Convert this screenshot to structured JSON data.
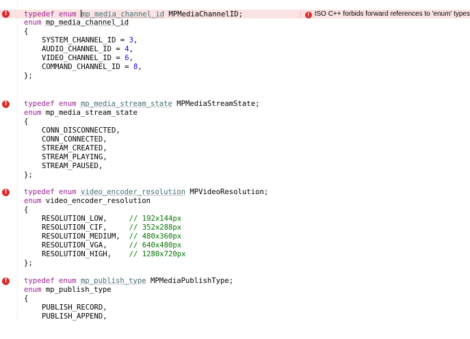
{
  "editor": {
    "error_message": "ISO C++ forbids forward references to 'enum' types",
    "error_marker": "!",
    "blocks": [
      {
        "typedef_kw": "typedef enum",
        "tag": "mp_media_channel_id",
        "typedef_name": "MPMediaChannelID;",
        "enum_kw": "enum",
        "enum_name": "mp_media_channel_id",
        "open": "{",
        "close": "};",
        "items": [
          {
            "name": "SYSTEM_CHANNEL_ID = ",
            "value": "3",
            "tail": ","
          },
          {
            "name": "AUDIO_CHANNEL_ID = ",
            "value": "4",
            "tail": ","
          },
          {
            "name": "VIDEO_CHANNEL_ID = ",
            "value": "6",
            "tail": ","
          },
          {
            "name": "COMMAND_CHANNEL_ID = ",
            "value": "8",
            "tail": ","
          }
        ]
      },
      {
        "typedef_kw": "typedef enum",
        "tag": "mp_media_stream_state",
        "typedef_name": "MPMediaStreamState;",
        "enum_kw": "enum",
        "enum_name": "mp_media_stream_state",
        "open": "{",
        "close": "};",
        "items": [
          {
            "name": "CONN_DISCONNECTED,"
          },
          {
            "name": "CONN_CONNECTED,"
          },
          {
            "name": "STREAM_CREATED,"
          },
          {
            "name": "STREAM_PLAYING,"
          },
          {
            "name": "STREAM_PAUSED,"
          }
        ]
      },
      {
        "typedef_kw": "typedef enum",
        "tag": "video_encoder_resolution",
        "typedef_name": "MPVideoResolution;",
        "enum_kw": "enum",
        "enum_name": "video_encoder_resolution",
        "open": "{",
        "close": "};",
        "items": [
          {
            "name": "RESOLUTION_LOW,     ",
            "comment": "// 192x144px"
          },
          {
            "name": "RESOLUTION_CIF,     ",
            "comment": "// 352x288px"
          },
          {
            "name": "RESOLUTION_MEDIUM,  ",
            "comment": "// 480x360px"
          },
          {
            "name": "RESOLUTION_VGA,     ",
            "comment": "// 640x480px"
          },
          {
            "name": "RESOLUTION_HIGH,    ",
            "comment": "// 1280x720px"
          }
        ]
      },
      {
        "typedef_kw": "typedef enum",
        "tag": "mp_publish_type",
        "typedef_name": "MPMediaPublishType;",
        "enum_kw": "enum",
        "enum_name": "mp_publish_type",
        "open": "{",
        "items": [
          {
            "name": "PUBLISH_RECORD,"
          },
          {
            "name": "PUBLISH_APPEND,"
          }
        ]
      }
    ]
  },
  "colors": {
    "error_line_bg": "#fbe3e3",
    "error_marker": "#d92b2b",
    "keyword": "#9b2393",
    "type_ref": "#3f6e74",
    "comment": "#007400",
    "number": "#1c00cf"
  }
}
